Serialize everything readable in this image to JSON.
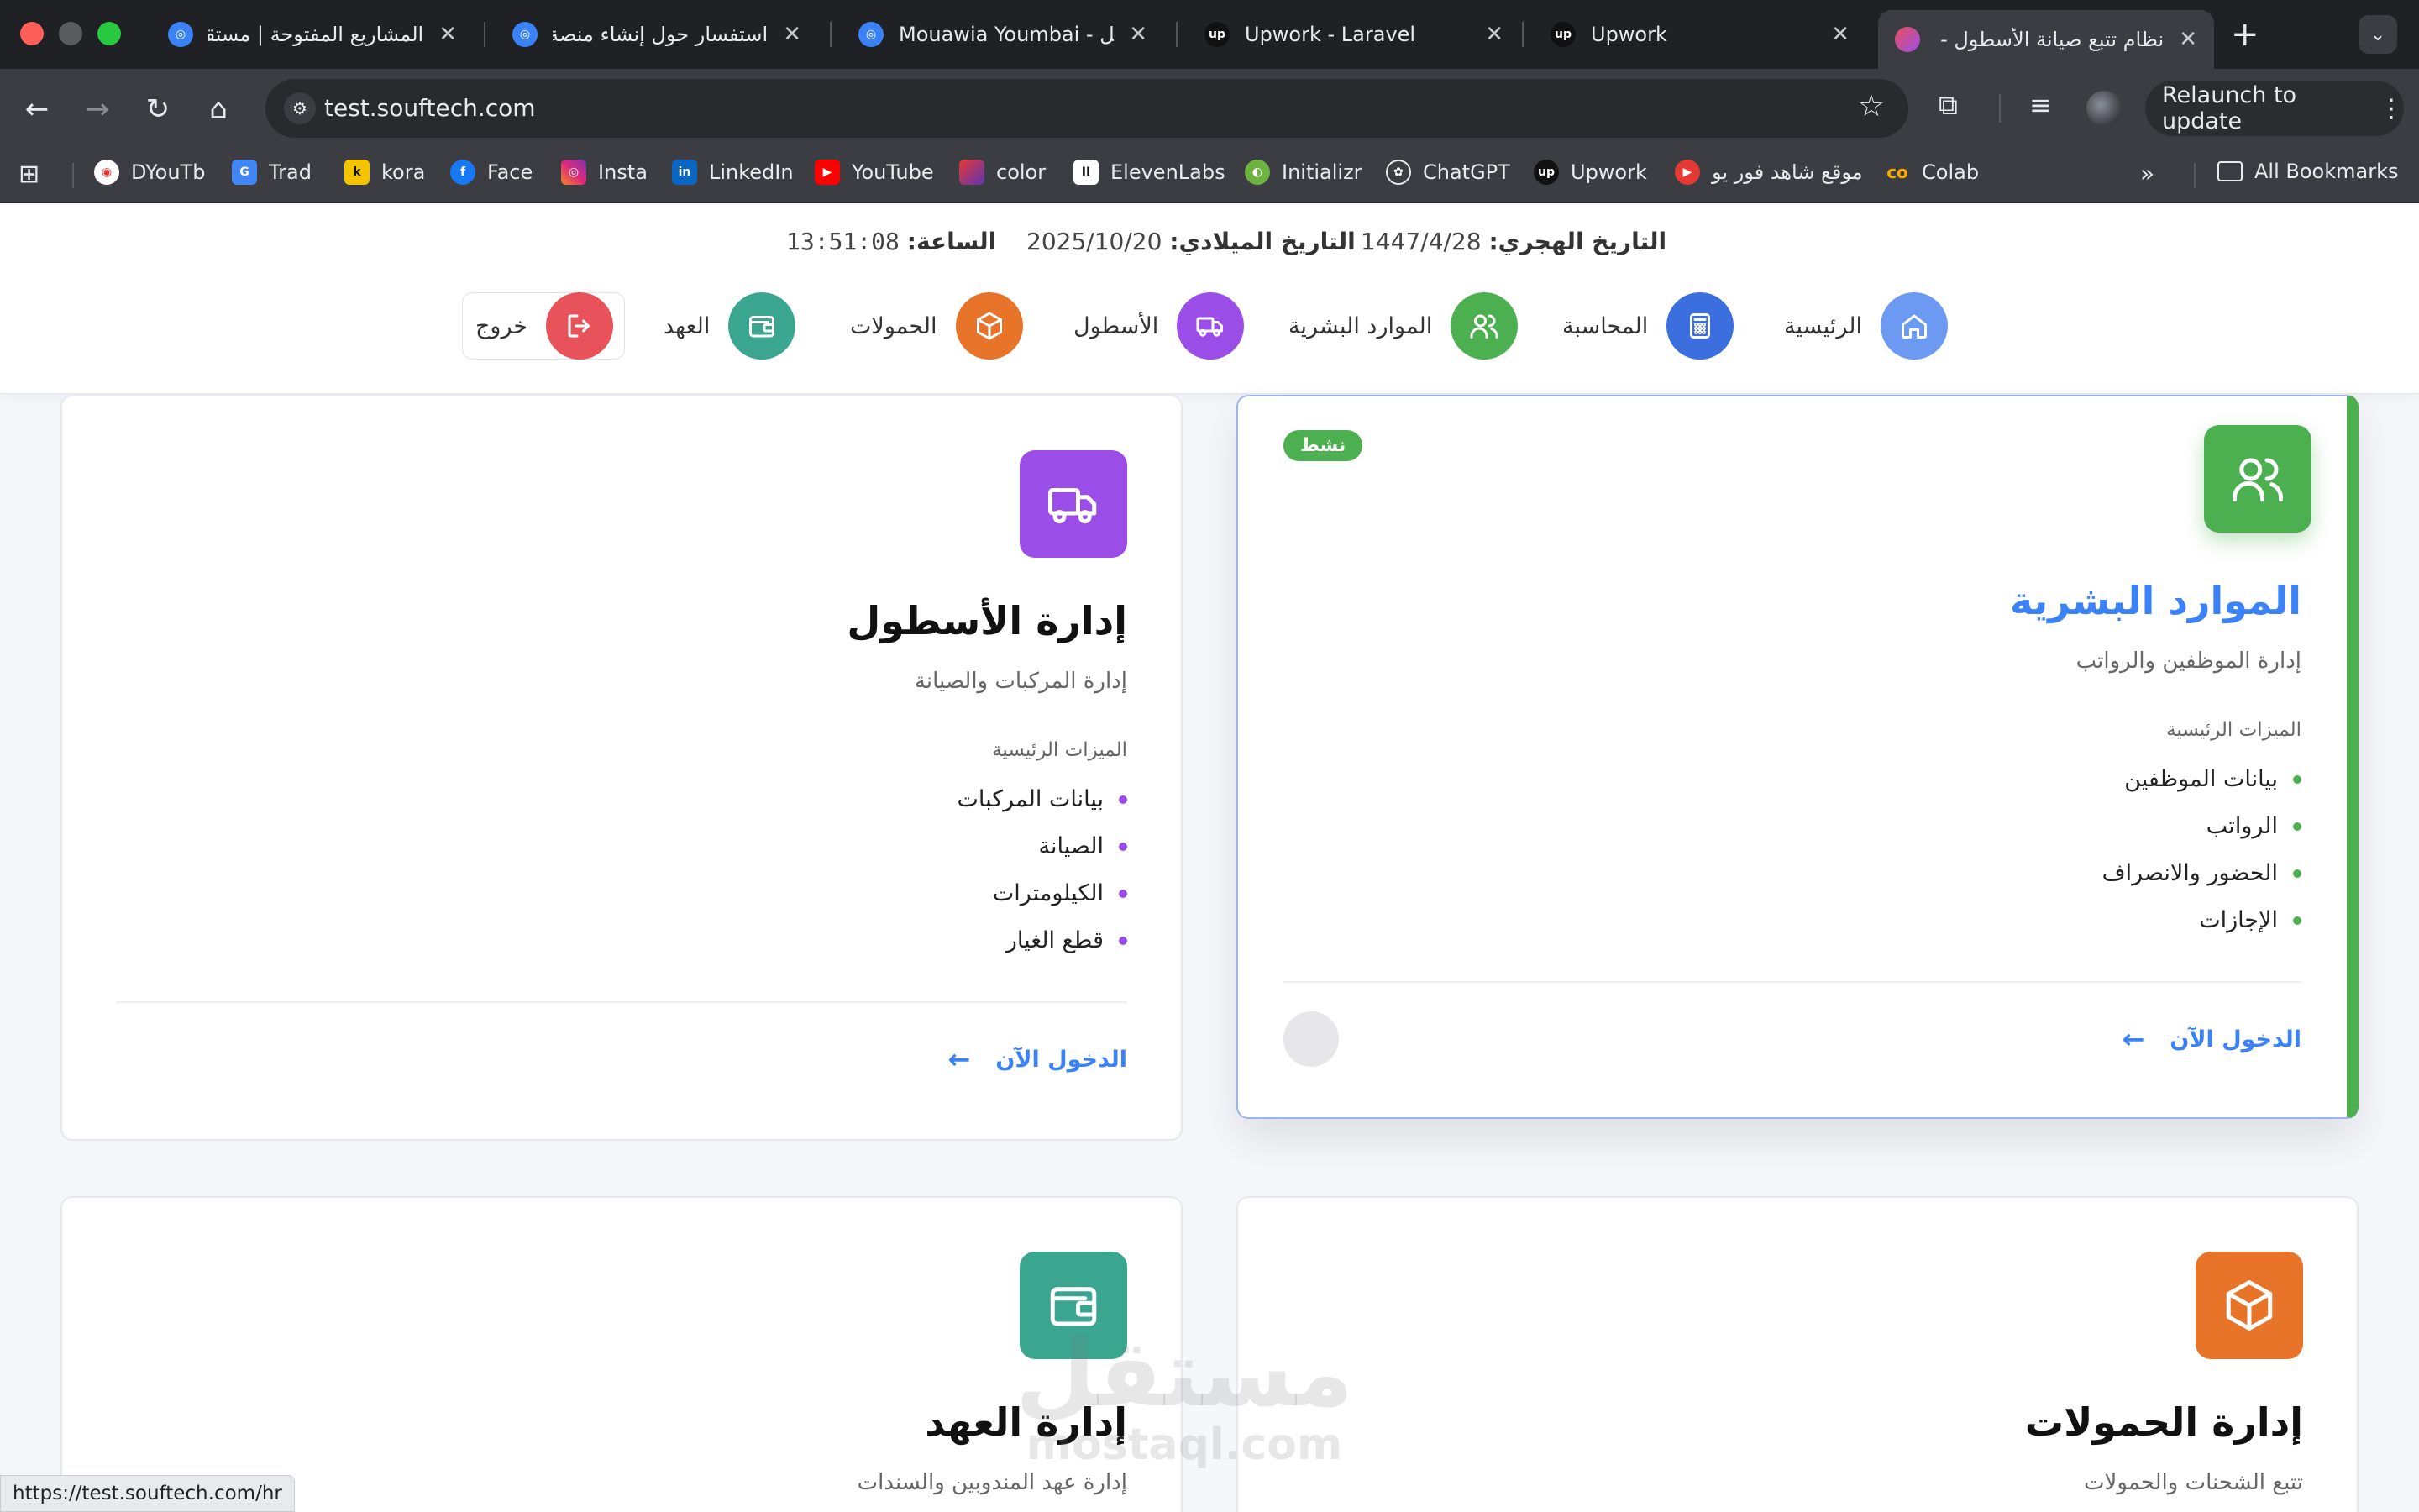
{
  "browser": {
    "tabs": [
      {
        "title": "المشاريع المفتوحة | مستقل",
        "active": false
      },
      {
        "title": "استفسار حول إنشاء منصة لمـ",
        "active": false
      },
      {
        "title": "Mouawia Youmbai - مستقل",
        "active": false
      },
      {
        "title": "Upwork - Laravel",
        "active": false
      },
      {
        "title": "Upwork",
        "active": false
      },
      {
        "title": "نظام تتبع صيانة الأسطول - ت",
        "active": true
      }
    ],
    "new_tab_glyph": "+",
    "url": "test.souftech.com",
    "relaunch_label": "Relaunch to update",
    "bookmarks": [
      "DYouTb",
      "Trad",
      "kora",
      "Face",
      "Insta",
      "LinkedIn",
      "YouTube",
      "color",
      "ElevenLabs",
      "Initializr",
      "ChatGPT",
      "Upwork",
      "موقع شاهد فور يو",
      "Colab"
    ],
    "all_bookmarks_label": "All Bookmarks",
    "status_url": "https://test.souftech.com/hr"
  },
  "header": {
    "hijri_label": "التاريخ الهجري:",
    "hijri_value": "1447/4/28",
    "gregorian_label": "التاريخ الميلادي:",
    "gregorian_value": "2025/10/20",
    "time_label": "الساعة:",
    "time_value": "13:51:08",
    "nav": [
      {
        "label": "الرئيسية",
        "icon": "home-icon",
        "color": "#5b8def"
      },
      {
        "label": "المحاسبة",
        "icon": "calculator-icon",
        "color": "#3b6fe0"
      },
      {
        "label": "الموارد البشرية",
        "icon": "users-icon",
        "color": "#4caf50"
      },
      {
        "label": "الأسطول",
        "icon": "truck-icon",
        "color": "#9b4de8"
      },
      {
        "label": "الحمولات",
        "icon": "box-icon",
        "color": "#e8742a"
      },
      {
        "label": "العهد",
        "icon": "wallet-icon",
        "color": "#3aa68f"
      },
      {
        "label": "خروج",
        "icon": "logout-icon",
        "color": "#e8535b"
      }
    ]
  },
  "cards": {
    "hr": {
      "badge": "نشط",
      "title": "الموارد البشرية",
      "subtitle": "إدارة الموظفين والرواتب",
      "features_heading": "الميزات الرئيسية",
      "features": [
        "بيانات الموظفين",
        "الرواتب",
        "الحضور والانصراف",
        "الإجازات"
      ],
      "enter_label": "الدخول الآن",
      "color": "#4caf50",
      "title_color": "#3b82f6"
    },
    "fleet": {
      "title": "إدارة الأسطول",
      "subtitle": "إدارة المركبات والصيانة",
      "features_heading": "الميزات الرئيسية",
      "features": [
        "بيانات المركبات",
        "الصيانة",
        "الكيلومترات",
        "قطع الغيار"
      ],
      "enter_label": "الدخول الآن",
      "color": "#9b4de8"
    },
    "loads": {
      "title": "إدارة الحمولات",
      "subtitle": "تتبع الشحنات والحمولات",
      "color": "#e8742a"
    },
    "custody": {
      "title": "إدارة العهد",
      "subtitle": "إدارة عهد المندوبين والسندات",
      "color": "#3aa68f"
    }
  },
  "watermark": {
    "arabic": "مستقل",
    "latin": "mostaql.com"
  }
}
